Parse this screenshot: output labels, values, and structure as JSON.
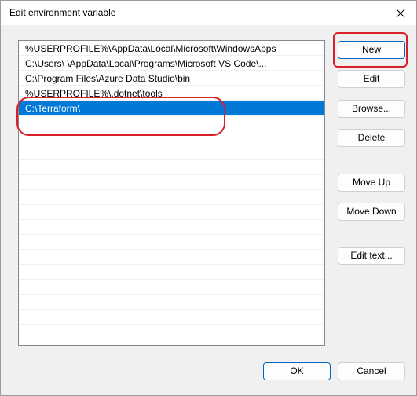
{
  "window": {
    "title": "Edit environment variable"
  },
  "list": {
    "items": [
      {
        "text": "%USERPROFILE%\\AppData\\Local\\Microsoft\\WindowsApps"
      },
      {
        "text": "C:\\Users\\                        \\AppData\\Local\\Programs\\Microsoft VS Code\\..."
      },
      {
        "text": "C:\\Program Files\\Azure Data Studio\\bin"
      },
      {
        "text": "%USERPROFILE%\\.dotnet\\tools"
      },
      {
        "text": "C:\\Terraform\\"
      }
    ],
    "selected_index": 4
  },
  "buttons": {
    "new": "New",
    "edit": "Edit",
    "browse": "Browse...",
    "delete": "Delete",
    "move_up": "Move Up",
    "move_down": "Move Down",
    "edit_text": "Edit text...",
    "ok": "OK",
    "cancel": "Cancel"
  },
  "colors": {
    "selection": "#0078d7",
    "annotation": "#d9202a"
  }
}
